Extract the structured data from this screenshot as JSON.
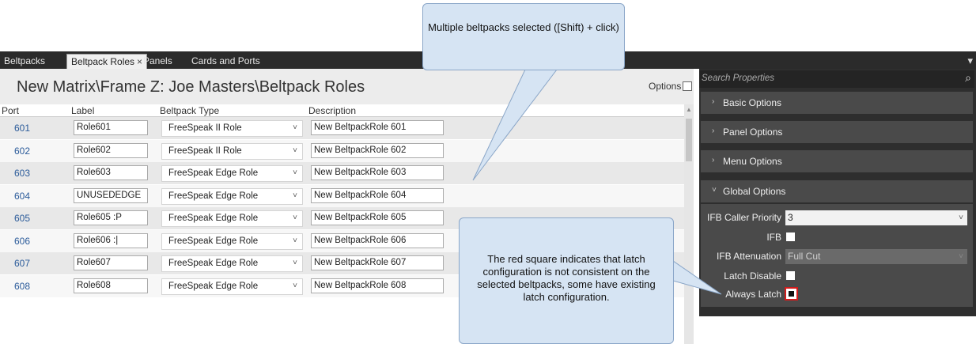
{
  "tabs": [
    "Beltpacks",
    "Beltpack Roles",
    "Panels",
    "Cards and Ports"
  ],
  "tab_close_glyph": "×",
  "page_title": "New Matrix\\Frame Z: Joe Masters\\Beltpack Roles",
  "options_label": "Options",
  "columns": {
    "port": "Port",
    "label": "Label",
    "type": "Beltpack Type",
    "desc": "Description"
  },
  "rows": [
    {
      "port": "601",
      "label": "Role601",
      "type": "FreeSpeak II Role",
      "desc": "New BeltpackRole 601"
    },
    {
      "port": "602",
      "label": "Role602",
      "type": "FreeSpeak II Role",
      "desc": "New BeltpackRole 602"
    },
    {
      "port": "603",
      "label": "Role603",
      "type": "FreeSpeak Edge Role",
      "desc": "New BeltpackRole 603"
    },
    {
      "port": "604",
      "label": "UNUSEDEDGE",
      "type": "FreeSpeak Edge Role",
      "desc": "New BeltpackRole 604"
    },
    {
      "port": "605",
      "label": "Role605 :P",
      "type": "FreeSpeak Edge Role",
      "desc": "New BeltpackRole 605"
    },
    {
      "port": "606",
      "label": "Role606 :|",
      "type": "FreeSpeak Edge Role",
      "desc": "New BeltpackRole 606"
    },
    {
      "port": "607",
      "label": "Role607",
      "type": "FreeSpeak Edge Role",
      "desc": "New BeltpackRole 607"
    },
    {
      "port": "608",
      "label": "Role608",
      "type": "FreeSpeak Edge Role",
      "desc": "New BeltpackRole 608"
    }
  ],
  "properties": {
    "search_placeholder": "Search Properties",
    "sections": [
      "Basic Options",
      "Panel Options",
      "Menu Options",
      "Global Options"
    ],
    "ifb_caller_priority_label": "IFB Caller Priority",
    "ifb_caller_priority_value": "3",
    "ifb_label": "IFB",
    "ifb_attenuation_label": "IFB Attenuation",
    "ifb_attenuation_value": "Full Cut",
    "latch_disable_label": "Latch Disable",
    "always_latch_label": "Always Latch"
  },
  "callouts": {
    "top": "Multiple beltpacks selected ([Shift) + click)",
    "bottom": "The red square indicates that latch configuration is not consistent on the selected beltpacks, some have existing latch configuration."
  },
  "icons": {
    "chevron_down": "˅",
    "chevron_right": "›",
    "search": "⌕",
    "menu": "▾"
  },
  "colors": {
    "indeterminate_outline": "#d21c1c",
    "callout_fill": "#d6e4f3",
    "port_text": "#2b5b9a"
  }
}
